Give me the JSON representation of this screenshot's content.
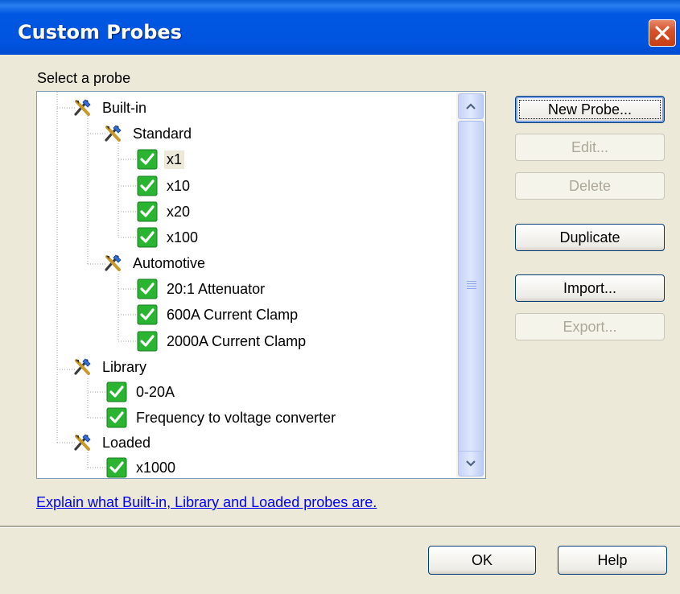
{
  "window": {
    "title": "Custom Probes"
  },
  "group_label": "Select a probe",
  "tree": {
    "nodes": [
      {
        "id": "builtin",
        "label": "Built-in",
        "type": "folder"
      },
      {
        "id": "standard",
        "label": "Standard",
        "type": "folder"
      },
      {
        "id": "x1",
        "label": "x1",
        "type": "probe",
        "selected": true
      },
      {
        "id": "x10",
        "label": "x10",
        "type": "probe"
      },
      {
        "id": "x20",
        "label": "x20",
        "type": "probe"
      },
      {
        "id": "x100",
        "label": "x100",
        "type": "probe"
      },
      {
        "id": "automotive",
        "label": "Automotive",
        "type": "folder"
      },
      {
        "id": "att20",
        "label": "20:1 Attenuator",
        "type": "probe"
      },
      {
        "id": "clamp600",
        "label": "600A Current Clamp",
        "type": "probe"
      },
      {
        "id": "clamp2000",
        "label": "2000A Current Clamp",
        "type": "probe"
      },
      {
        "id": "library",
        "label": "Library",
        "type": "folder"
      },
      {
        "id": "a020",
        "label": "0-20A",
        "type": "probe"
      },
      {
        "id": "f2v",
        "label": "Frequency to voltage converter",
        "type": "probe"
      },
      {
        "id": "loaded",
        "label": "Loaded",
        "type": "folder"
      },
      {
        "id": "x1000",
        "label": "x1000",
        "type": "probe"
      }
    ]
  },
  "buttons": {
    "new_probe": "New Probe...",
    "edit": "Edit...",
    "delete": "Delete",
    "duplicate": "Duplicate",
    "import": "Import...",
    "export": "Export...",
    "ok": "OK",
    "help": "Help"
  },
  "link_text": "Explain what Built-in, Library and Loaded probes are.",
  "icons": {
    "folder": "probe-tools-icon",
    "probe": "checkmark-probe-icon",
    "close": "close-icon"
  },
  "colors": {
    "titlebar": "#0054e0",
    "close_button": "#d8532a",
    "check_green": "#2ab431",
    "link": "#0000ff"
  }
}
